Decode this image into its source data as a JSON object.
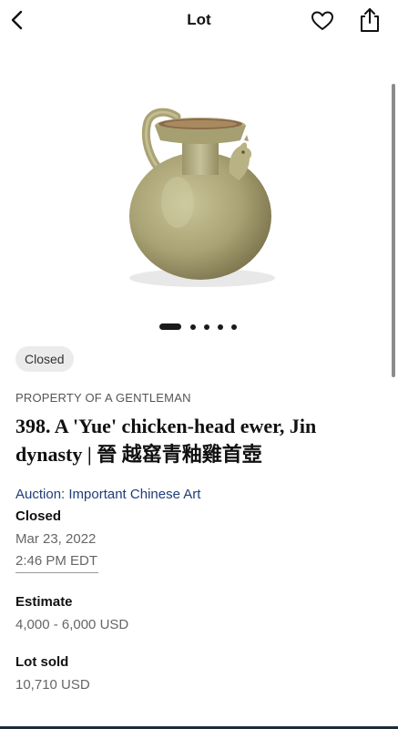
{
  "header": {
    "title": "Lot",
    "back_icon": "chevron-left-icon",
    "favorite_icon": "heart-icon",
    "share_icon": "share-icon"
  },
  "gallery": {
    "image_description_icon": "ewer-image",
    "dot_count": 5,
    "active_dot": 0
  },
  "lot": {
    "status_badge": "Closed",
    "provenance": "PROPERTY OF A GENTLEMAN",
    "title": "398. A 'Yue' chicken-head ewer, Jin dynasty | 晉 越窰青釉雞首壺",
    "auction_link": "Auction: Important Chinese Art",
    "closed_label": "Closed",
    "closed_date": "Mar 23, 2022",
    "closed_time": "2:46 PM EDT",
    "estimate_label": "Estimate",
    "estimate_value": "4,000 - 6,000 USD",
    "sold_label": "Lot sold",
    "sold_value": "10,710 USD"
  },
  "colors": {
    "link": "#1f3d78",
    "pill_bg": "#ebebeb",
    "bottom_bar": "#1b2a3a"
  }
}
